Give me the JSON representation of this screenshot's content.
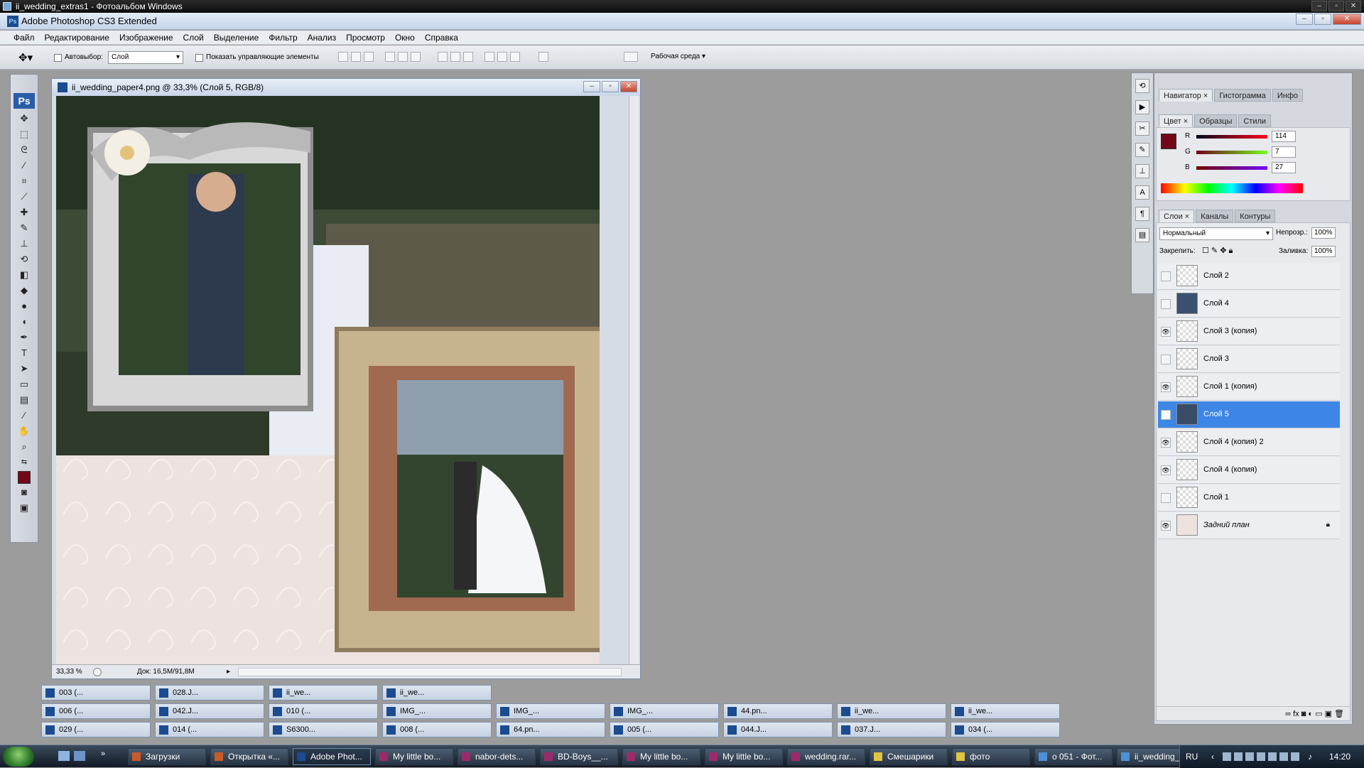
{
  "os_window": {
    "title": "ii_wedding_extras1 - Фотоальбом Windows"
  },
  "app": {
    "title": "Adobe Photoshop CS3 Extended"
  },
  "menu": [
    "Файл",
    "Редактирование",
    "Изображение",
    "Слой",
    "Выделение",
    "Фильтр",
    "Анализ",
    "Просмотр",
    "Окно",
    "Справка"
  ],
  "options_bar": {
    "autoselect_label": "Автовыбор:",
    "autoselect_value": "Слой",
    "show_controls_label": "Показать управляющие элементы",
    "workspace_label": "Рабочая среда"
  },
  "document": {
    "title": "ii_wedding_paper4.png @ 33,3% (Слой 5, RGB/8)",
    "zoom": "33,33 %",
    "doc_size": "Док: 16,5M/91,8M"
  },
  "panels": {
    "group1_tabs": [
      "Навигатор",
      "Гистограмма",
      "Инфо"
    ],
    "group2_tabs": [
      "Цвет",
      "Образцы",
      "Стили"
    ],
    "color": {
      "r_label": "R",
      "g_label": "G",
      "b_label": "B",
      "r": "114",
      "g": "7",
      "b": "27",
      "swatch": "#72071b"
    },
    "layers_tabs": [
      "Слои",
      "Каналы",
      "Контуры"
    ],
    "blend_mode": "Нормальный",
    "opacity_label": "Непрозр.:",
    "opacity": "100%",
    "lock_label": "Закрепить:",
    "fill_label": "Заливка:",
    "fill": "100%",
    "layers": [
      {
        "name": "Слой 2",
        "visible": false
      },
      {
        "name": "Слой 4",
        "visible": false
      },
      {
        "name": "Слой 3 (копия)",
        "visible": true
      },
      {
        "name": "Слой 3",
        "visible": false
      },
      {
        "name": "Слой 1 (копия)",
        "visible": true
      },
      {
        "name": "Слой 5",
        "visible": true
      },
      {
        "name": "Слой 4 (копия) 2",
        "visible": true
      },
      {
        "name": "Слой 4 (копия)",
        "visible": true
      },
      {
        "name": "Слой 1",
        "visible": false
      },
      {
        "name": "Задний план",
        "visible": true
      }
    ]
  },
  "doc_tabs": [
    [
      "003 (...",
      "028.J...",
      "ii_we...",
      "ii_we..."
    ],
    [
      "006 (...",
      "042.J...",
      "010 (...",
      "IMG_...",
      "IMG_...",
      "IMG_...",
      "44.pn...",
      "ii_we...",
      "ii_we..."
    ],
    [
      "029 (...",
      "014 (...",
      "S6300...",
      "008 (...",
      "64.pn...",
      "005 (...",
      "044.J...",
      "037.J...",
      "034 (..."
    ]
  ],
  "taskbar": {
    "items": [
      "Загрузки",
      "Открытка «...",
      "Adobe Phot...",
      "My little bo...",
      "nabor-dets...",
      "BD-Boys__...",
      "My little bo...",
      "My little bo...",
      "wedding.rar...",
      "Смешарики",
      "фото",
      "о 051 - Фот...",
      "ii_wedding_..."
    ],
    "lang": "RU",
    "clock": "14:20"
  }
}
